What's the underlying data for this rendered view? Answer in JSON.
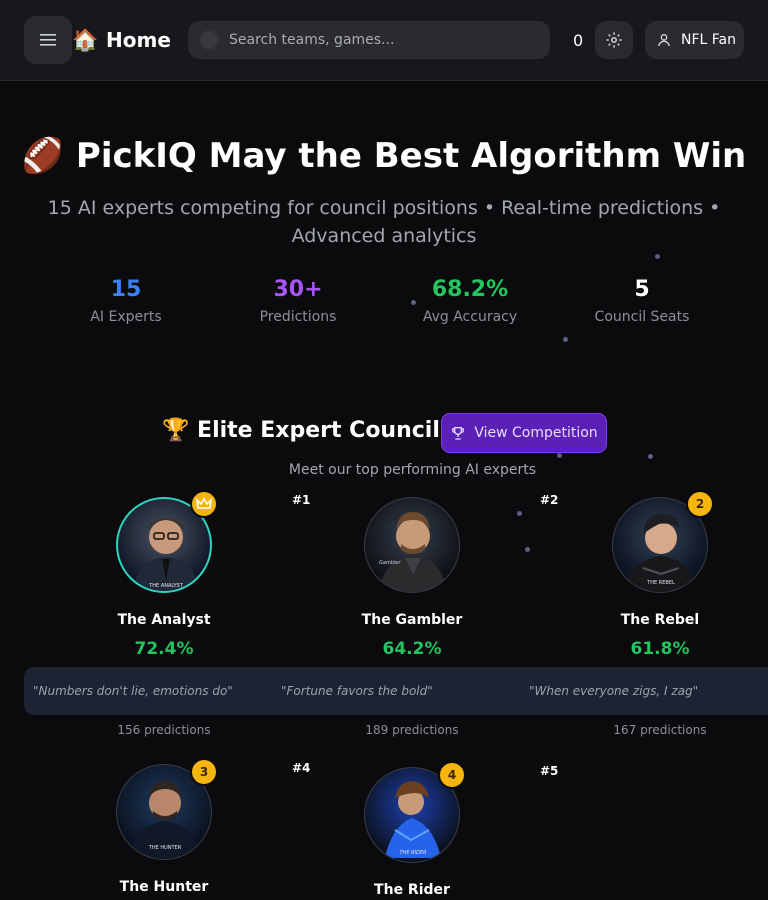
{
  "header": {
    "home_emoji": "🏠",
    "home_label": "Home",
    "search_placeholder": "Search teams, games...",
    "counter": "0",
    "user_label": "NFL Fan"
  },
  "hero": {
    "title": "🏈 PickIQ May the Best Algorithm Win",
    "subtitle": "15 AI experts competing for council positions • Real-time predictions • Advanced analytics",
    "stats": [
      {
        "value": "15",
        "label": "AI Experts",
        "color": "#3b82f6"
      },
      {
        "value": "30+",
        "label": "Predictions",
        "color": "#a855f7"
      },
      {
        "value": "68.2%",
        "label": "Avg Accuracy",
        "color": "#22c55e"
      },
      {
        "value": "5",
        "label": "Council Seats",
        "color": "#ffffff"
      }
    ]
  },
  "council": {
    "title": "🏆 Elite Expert Council",
    "button_label": "View Competition",
    "subtitle": "Meet our top performing AI experts",
    "experts": [
      {
        "name": "The Analyst",
        "accuracy": "72.4%",
        "quote": "\"Numbers don't lie, emotions do\"",
        "predictions": "156 predictions",
        "rank": "#1",
        "badge": "crown",
        "image_text": "THE ANALYST"
      },
      {
        "name": "The Gambler",
        "accuracy": "64.2%",
        "quote": "\"Fortune favors the bold\"",
        "predictions": "189 predictions",
        "rank": "#2",
        "badge": "",
        "image_text": "Gambler"
      },
      {
        "name": "The Rebel",
        "accuracy": "61.8%",
        "quote": "\"When everyone zigs, I zag\"",
        "predictions": "167 predictions",
        "rank": "",
        "badge": "2",
        "image_text": "THE REBEL"
      },
      {
        "name": "The Hunter",
        "rank": "#4",
        "badge": "3",
        "image_text": "THE HUNTER"
      },
      {
        "name": "The Rider",
        "rank": "#5",
        "badge": "4",
        "image_text": "THE RIDER"
      }
    ]
  },
  "colors": {
    "accent": "#5b21b6",
    "accuracy": "#22c55e",
    "badge": "#f5b50f"
  }
}
